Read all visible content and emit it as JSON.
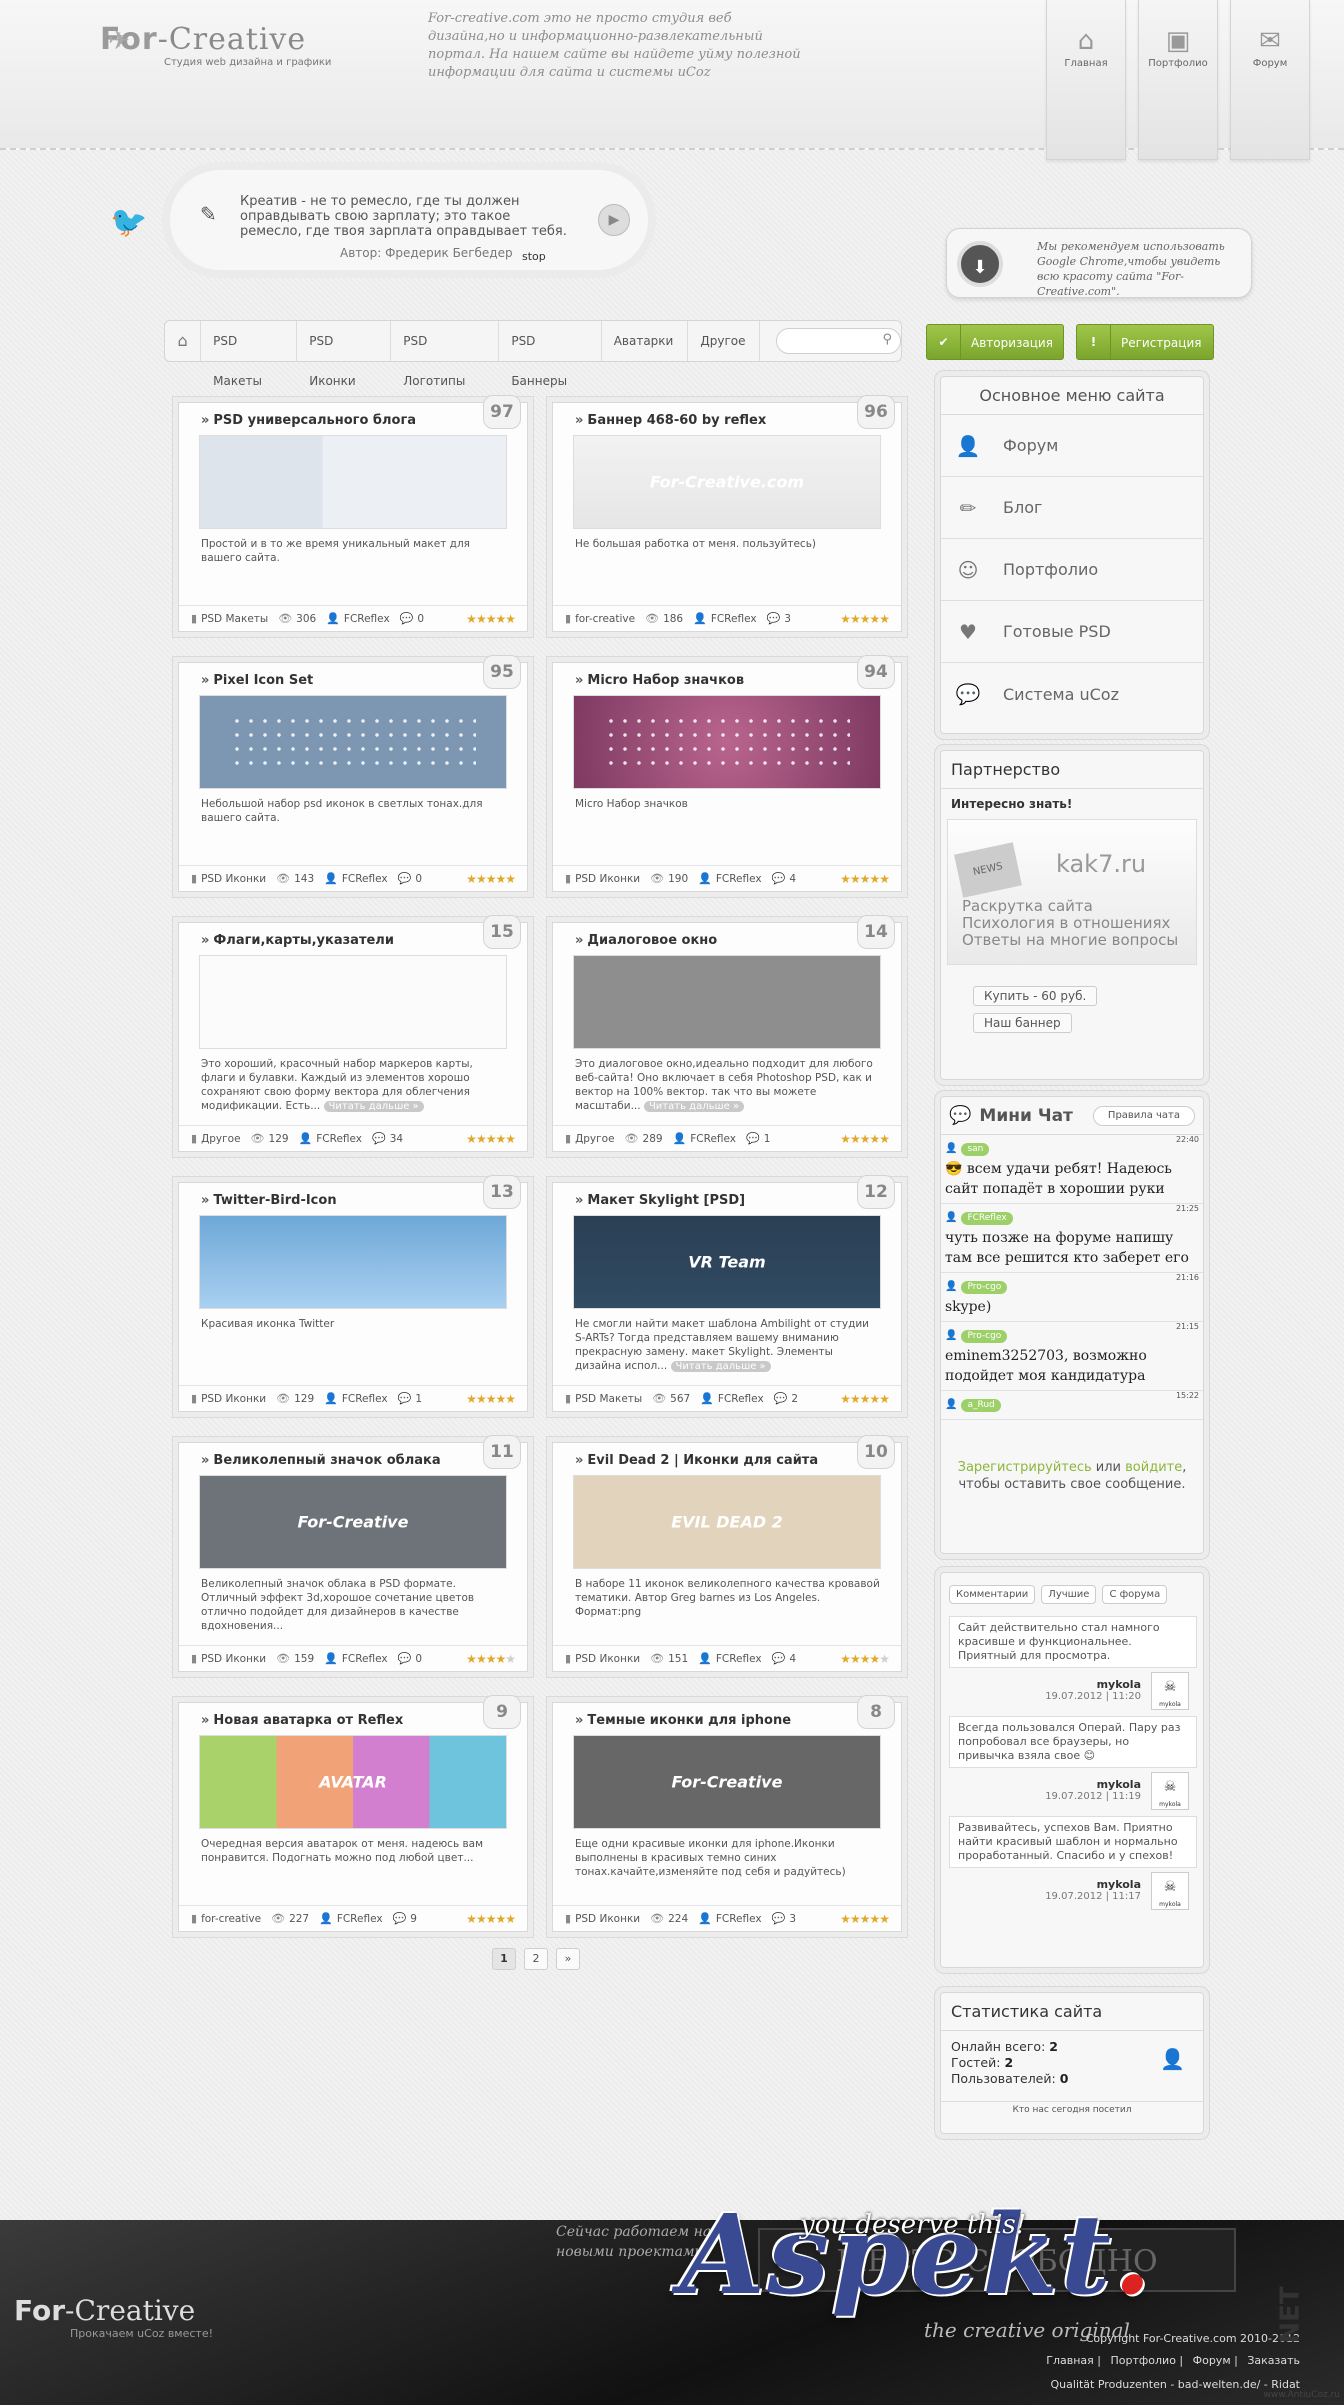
{
  "header": {
    "logo_name": "For",
    "logo_name2": "-Creative",
    "logo_tagline": "Студия web дизайна и графики",
    "note": "For-creative.com это не просто студия веб дизайна,но и информационно-развлекательный портал. На нашем сайте вы найдете уйму полезной информации для сайта и системы uCoz",
    "nav": [
      {
        "label": "Главная",
        "icon": "home-icon"
      },
      {
        "label": "Портфолио",
        "icon": "briefcase-icon"
      },
      {
        "label": "Форум",
        "icon": "mail-icon"
      }
    ]
  },
  "quote": {
    "text": "Креатив - не то ремесло, где ты должен оправдывать свою зарплату; это такое ремесло, где твоя зарплата оправдывает тебя.",
    "author": "Автор: Фредерик Бегбедер",
    "stop": "stop"
  },
  "chrome_note": "Мы рекомендуем использовать Google Chrome,чтобы увидеть всю красоту сайта \"For-Creative.com\".",
  "crumbs": [
    "PSD Макеты",
    "PSD Иконки",
    "PSD Логотипы",
    "PSD Баннеры",
    "Аватарки",
    "Другое"
  ],
  "auth": {
    "login": "Авторизация",
    "register": "Регистрация"
  },
  "cards": [
    {
      "num": "97",
      "title": "PSD универсального блога",
      "desc": "Простой и в то же время уникальный макет для вашего сайта.",
      "readmore": "",
      "cat": "PSD Макеты",
      "views": "306",
      "author": "FCReflex",
      "comments": "0",
      "rating": 5
    },
    {
      "num": "96",
      "title": "Баннер 468-60 by reflex",
      "desc": "Не большая работка от меня. пользуйтесь)",
      "readmore": "",
      "cat": "for-creative",
      "views": "186",
      "author": "FCReflex",
      "comments": "3",
      "rating": 5,
      "overlay": "For-Creative.com"
    },
    {
      "num": "95",
      "title": "Pixel Icon Set",
      "desc": "Небольшой набор psd иконок в светлых тонах.для вашего сайта.",
      "readmore": "",
      "cat": "PSD Иконки",
      "views": "143",
      "author": "FCReflex",
      "comments": "0",
      "rating": 5
    },
    {
      "num": "94",
      "title": "Micro Набор значков",
      "desc": "Micro Набор значков",
      "readmore": "",
      "cat": "PSD Иконки",
      "views": "190",
      "author": "FCReflex",
      "comments": "4",
      "rating": 5
    },
    {
      "num": "15",
      "title": "Флаги,карты,указатели",
      "desc": "Это хороший, красочный набор маркеров карты, флаги и булавки. Каждый из элементов хорошо сохраняют свою форму вектора для облегчения модификации. Есть...",
      "readmore": "Читать дальше »",
      "cat": "Другое",
      "views": "129",
      "author": "FCReflex",
      "comments": "34",
      "rating": 5
    },
    {
      "num": "14",
      "title": "Диалоговое окно",
      "desc": "Это диалоговое окно,идеально подходит для любого веб-сайта! Оно включает в себя Photoshop PSD, как и вектор на 100% вектор. так что вы можете масштаби...",
      "readmore": "Читать дальше »",
      "cat": "Другое",
      "views": "289",
      "author": "FCReflex",
      "comments": "1",
      "rating": 5
    },
    {
      "num": "13",
      "title": "Twitter-Bird-Icon",
      "desc": "Красивая иконка Twitter",
      "readmore": "",
      "cat": "PSD Иконки",
      "views": "129",
      "author": "FCReflex",
      "comments": "1",
      "rating": 5
    },
    {
      "num": "12",
      "title": "Макет Skylight [PSD]",
      "desc": "Не смогли найти макет шаблона Ambilight от студии S-ARTs? Тогда представляем вашему вниманию прекрасную замену. макет Skylight. Элементы дизайна испол...",
      "readmore": "Читать дальше »",
      "cat": "PSD Макеты",
      "views": "567",
      "author": "FCReflex",
      "comments": "2",
      "rating": 5,
      "overlay": "VR Team"
    },
    {
      "num": "11",
      "title": "Великолепный значок облака",
      "desc": "Великолепный значок облака в PSD формате. Отличный эффект 3d,хорошое сочетание цветов отлично подойдет для дизайнеров в качестве вдохновения...",
      "readmore": "",
      "cat": "PSD Иконки",
      "views": "159",
      "author": "FCReflex",
      "comments": "0",
      "rating": 4,
      "overlay": "For-Creative"
    },
    {
      "num": "10",
      "title": "Evil Dead 2 | Иконки для сайта",
      "desc": "В наборе 11 иконок великолепного качества кровавой тематики. Автор Greg barnes из Los Angeles. Формат:png",
      "readmore": "",
      "cat": "PSD Иконки",
      "views": "151",
      "author": "FCReflex",
      "comments": "4",
      "rating": 4,
      "overlay": "EVIL DEAD 2"
    },
    {
      "num": "9",
      "title": "Новая аватарка от Reflex",
      "desc": "Очередная версия аватарок от меня. надеюсь вам понравится. Подогнать можно под любой цвет...",
      "readmore": "",
      "cat": "for-creative",
      "views": "227",
      "author": "FCReflex",
      "comments": "9",
      "rating": 5,
      "overlay": "AVATAR"
    },
    {
      "num": "8",
      "title": "Темные иконки для iphone",
      "desc": "Еще одни красивые иконки для iphone.Иконки выполнены в красивых темно синих тонах.качайте,изменяйте под себя и радуйтесь)",
      "readmore": "",
      "cat": "PSD Иконки",
      "views": "224",
      "author": "FCReflex",
      "comments": "3",
      "rating": 5,
      "overlay": "For-Creative"
    }
  ],
  "pager": {
    "current": "1",
    "page2": "2",
    "next": "»"
  },
  "sidebar": {
    "menu_title": "Основное меню сайта",
    "menu": [
      {
        "label": "Форум",
        "icon": "user-icon"
      },
      {
        "label": "Блог",
        "icon": "pencil-icon"
      },
      {
        "label": "Портфолио",
        "icon": "smile-icon"
      },
      {
        "label": "Готовые PSD",
        "icon": "heart-icon"
      },
      {
        "label": "Система uCoz",
        "icon": "chat-icon"
      }
    ],
    "partner_title": "Партнерство",
    "partner_interest": "Интересно знать!",
    "partner_site": "kak7.ru",
    "partner_news": "NEWS",
    "partner_items": [
      "Раскрутка сайта",
      "Психология в отношениях",
      "Ответы на многие вопросы"
    ],
    "partner_buy": "Купить - 60 руб.",
    "partner_banner": "Наш баннер",
    "chat_title": "Мини Чат",
    "chat_rules": "Правила чата",
    "chat": [
      {
        "user": "san",
        "time": "22:40",
        "text": "😎 всем удачи ребят! Надеюсь сайт попадёт в хорошии руки"
      },
      {
        "user": "FCReflex",
        "time": "21:25",
        "text": "чуть позже на форуме напишу там все решится кто заберет его"
      },
      {
        "user": "Pro-cgo",
        "time": "21:16",
        "text": "skype)"
      },
      {
        "user": "Pro-cgo",
        "time": "21:15",
        "text": "eminem3252703, возможно подойдет моя кандидатура"
      },
      {
        "user": "a_Rud",
        "time": "15:22",
        "text": ""
      }
    ],
    "chat_note_register": "Зарегистрируйтесь",
    "chat_note_or": " или ",
    "chat_note_login": "войдите",
    "chat_note_rest": ", чтобы оставить свое сообщение.",
    "comment_tabs": [
      "Комментарии",
      "Лучшие",
      "С форума"
    ],
    "comments": [
      {
        "text": "Сайт действительно стал намного красивше и функциональнее. Приятный для просмотра.",
        "user": "mykola",
        "date": "19.07.2012 | 11:20"
      },
      {
        "text": "Всегда пользовался Операй. Пару раз попробовал все браузеры, но привычка взяла свое 😊",
        "user": "mykola",
        "date": "19.07.2012 | 11:19"
      },
      {
        "text": "Развивайтесь, успехов Вам. Приятно найти красивый шаблон и нормально проработанный. Спасибо и у спехов!",
        "user": "mykola",
        "date": "19.07.2012 | 11:17"
      }
    ],
    "stats_title": "Статистика сайта",
    "stats": [
      {
        "label": "Онлайн всего:",
        "value": "2"
      },
      {
        "label": "Гостей:",
        "value": "2"
      },
      {
        "label": "Пользователей:",
        "value": "0"
      }
    ],
    "stats_who": "Кто нас сегодня посетил"
  },
  "footer": {
    "now": "Сейчас работаем над новыми проектами",
    "placeholder": "МЕСТО СВОБОДНО",
    "logo_name": "For",
    "logo_name2": "-Creative",
    "sub": "Прокачаем uCoz вместе!",
    "copy": "Copyright For-Creative.com 2010-2012",
    "links": [
      "Главная |",
      "Портфолио |",
      "Форум |",
      "Заказать"
    ],
    "qual": "Qualität Produzenten - bad-welten.de/ - Ridat"
  },
  "watermark": {
    "main": "Aspekt",
    "dot": ".",
    "net": "NET",
    "slogan": "you deserve this!",
    "tag": "the creative original",
    "site": "www.AntiuCoz.ru"
  }
}
